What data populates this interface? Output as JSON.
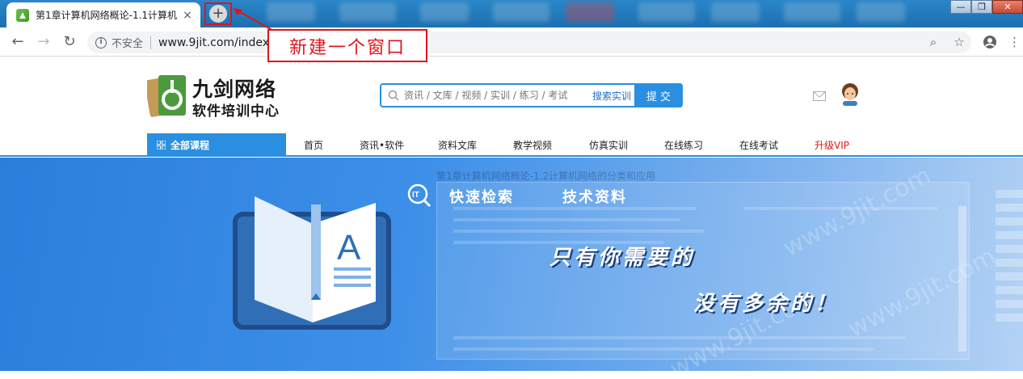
{
  "browser": {
    "tab_title": "第1章计算机网络概论-1.1计算机",
    "tab_close": "×",
    "newtab_label": "+",
    "security_label": "不安全",
    "url": "www.9jit.com/index",
    "back": "←",
    "forward": "→",
    "reload": "↻",
    "win_minimize": "—",
    "win_maximize": "❐",
    "win_close": "✕",
    "zoom_icon": "⌕",
    "star_icon": "☆",
    "menu_icon": "⋮"
  },
  "annotation": {
    "callout_text": "新建一个窗口",
    "color": "#e0141b"
  },
  "site": {
    "logo_line1": "九剑网络",
    "logo_line2": "软件培训中心",
    "search_placeholder": "资讯 / 文库 / 视频 / 实训 / 练习 / 考试",
    "search_tag": "搜索实训",
    "search_button": "提 交",
    "accent": "#2a8fe0"
  },
  "nav": {
    "all_courses": "全部课程",
    "items": [
      "首页",
      "资讯•软件",
      "资料文库",
      "教学视频",
      "仿真实训",
      "在线练习",
      "在线考试",
      "升级VIP"
    ]
  },
  "banner": {
    "sub1": "快速检索",
    "sub2": "技术资料",
    "line1": "只有你需要的",
    "line2": "没有多余的！",
    "ghost_title": "第1章计算机网络概论-1.2计算机网络的分类和应用",
    "watermark": "www.9jit.com"
  }
}
